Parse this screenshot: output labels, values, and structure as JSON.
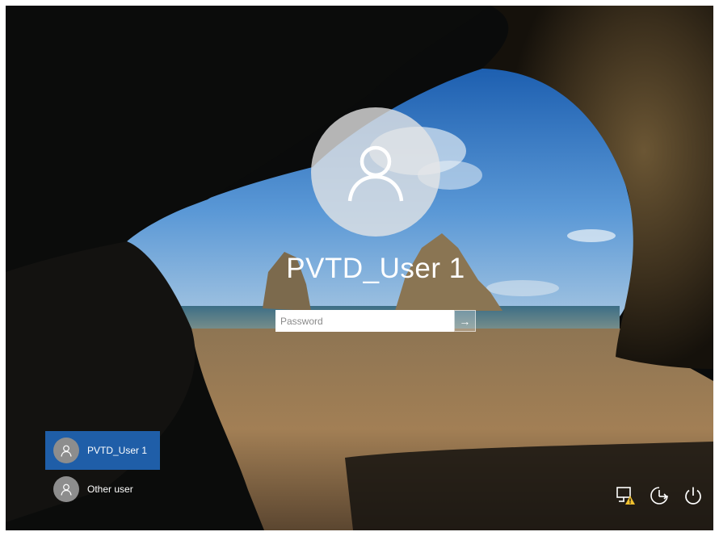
{
  "user": {
    "name": "PVTD_User 1"
  },
  "login": {
    "password_placeholder": "Password",
    "submit_glyph": "→"
  },
  "user_list": [
    {
      "label": "PVTD_User 1",
      "selected": true
    },
    {
      "label": "Other user",
      "selected": false
    }
  ],
  "tray_icons": [
    "network-warning-icon",
    "ease-of-access-icon",
    "power-icon"
  ],
  "colors": {
    "selected_user_bg": "#1f5ea8",
    "avatar_circle": "#e6e6e6",
    "sky": "#3a7bc4",
    "sand": "#a07e55",
    "cave": "#1a1610"
  }
}
